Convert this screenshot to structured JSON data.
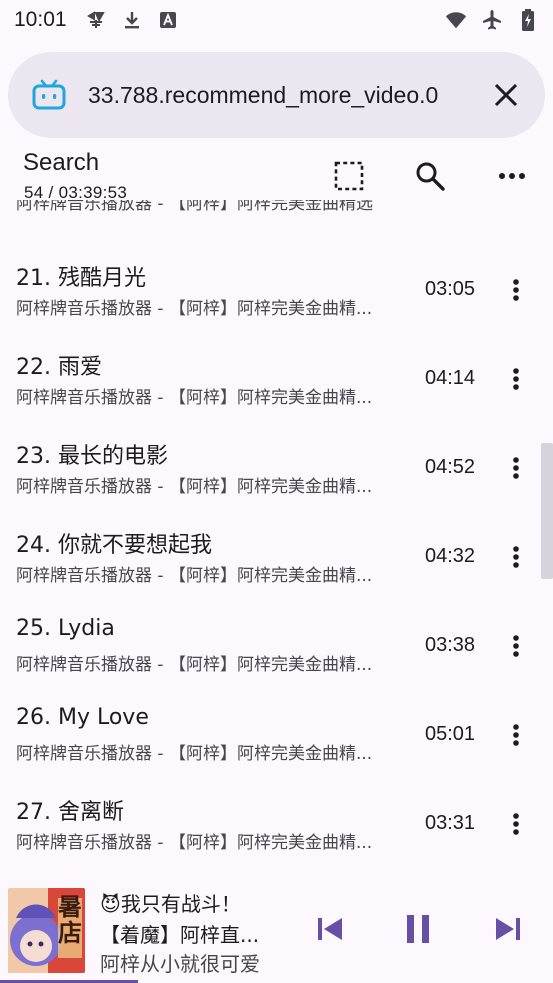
{
  "status_bar": {
    "time": "10:01",
    "left_icons": [
      "app-notification-icon",
      "download-icon",
      "text-app-icon"
    ],
    "right_icons": [
      "wifi-icon",
      "airplane-mode-icon",
      "battery-charging-icon"
    ]
  },
  "url_bar": {
    "url": "33.788.recommend_more_video.0",
    "site_icon": "bilibili-tv-icon",
    "close_icon": "close-icon"
  },
  "header": {
    "title": "Search",
    "subtitle": "54 / 03:39:53",
    "actions": [
      "select-area-icon",
      "search-icon",
      "more-horizontal-icon"
    ]
  },
  "list": {
    "partial_top_subtitle": "阿梓牌音乐播放器 - 【阿梓】阿梓完美金曲精选",
    "items": [
      {
        "title": "21. 残酷月光",
        "subtitle": "阿梓牌音乐播放器 - 【阿梓】阿梓完美金曲精...",
        "duration": "03:05"
      },
      {
        "title": "22. 雨爱",
        "subtitle": "阿梓牌音乐播放器 - 【阿梓】阿梓完美金曲精...",
        "duration": "04:14"
      },
      {
        "title": "23. 最长的电影",
        "subtitle": "阿梓牌音乐播放器 - 【阿梓】阿梓完美金曲精...",
        "duration": "04:52"
      },
      {
        "title": "24. 你就不要想起我",
        "subtitle": "阿梓牌音乐播放器 - 【阿梓】阿梓完美金曲精...",
        "duration": "04:32"
      },
      {
        "title": "25. Lydia",
        "subtitle": "阿梓牌音乐播放器 - 【阿梓】阿梓完美金曲精...",
        "duration": "03:38"
      },
      {
        "title": "26. My Love",
        "subtitle": "阿梓牌音乐播放器 - 【阿梓】阿梓完美金曲精...",
        "duration": "05:01"
      },
      {
        "title": "27. 舍离断",
        "subtitle": "阿梓牌音乐播放器 - 【阿梓】阿梓完美金曲精...",
        "duration": "03:31"
      }
    ]
  },
  "player": {
    "line1": "😈我只有战斗！",
    "line2": "【着魔】阿梓直...",
    "line3": "阿梓从小就很可爱",
    "cover_text": "暑\n店",
    "progress": 0.25,
    "accent_color": "#6750a4"
  }
}
